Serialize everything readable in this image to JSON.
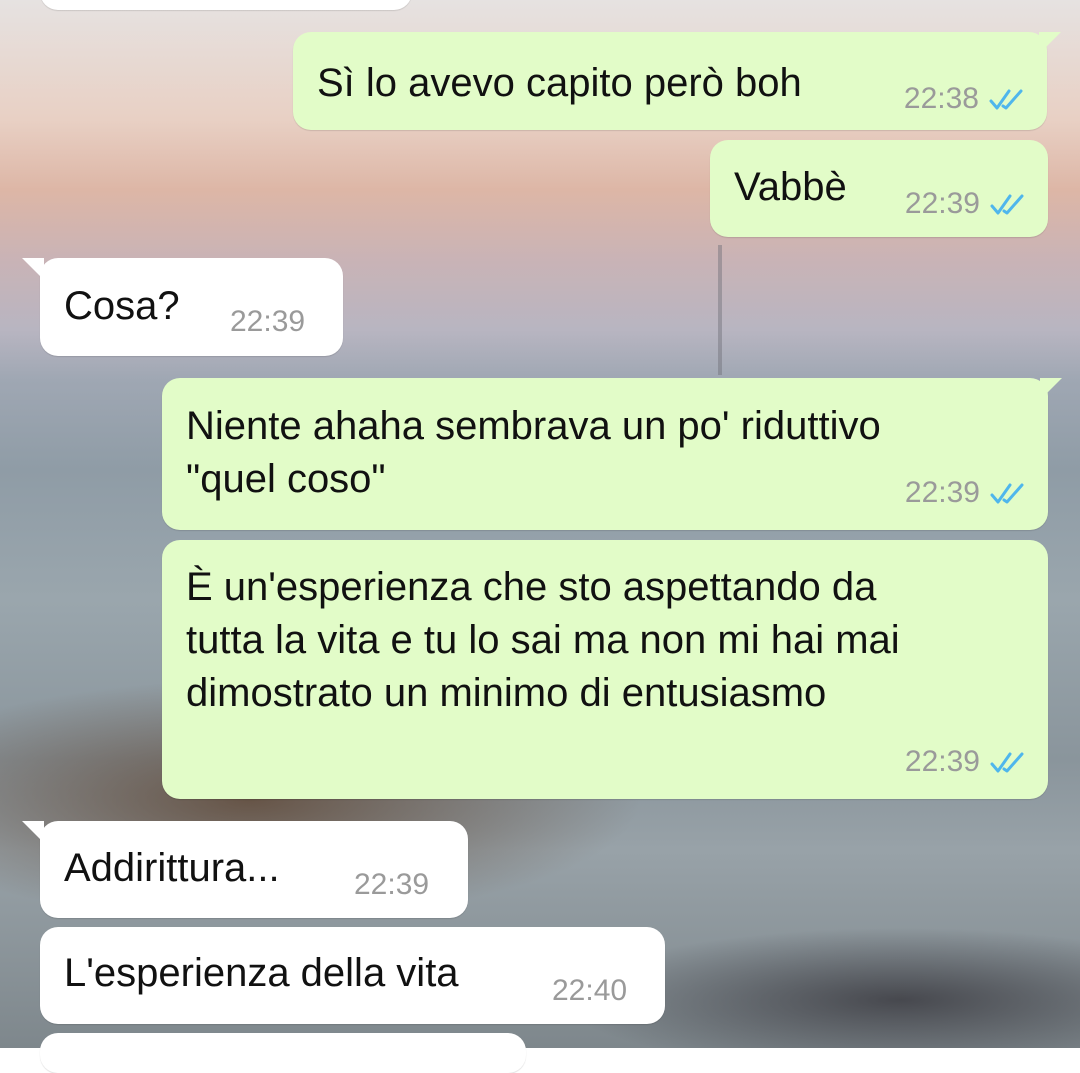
{
  "chat": {
    "messages": [
      {
        "direction": "outgoing",
        "text": "Sì lo avevo capito però boh",
        "time": "22:38",
        "status": "read"
      },
      {
        "direction": "outgoing",
        "text": "Vabbè",
        "time": "22:39",
        "status": "read"
      },
      {
        "direction": "incoming",
        "text": "Cosa?",
        "time": "22:39"
      },
      {
        "direction": "outgoing",
        "text_lines": [
          "Niente ahaha sembrava un po' riduttivo",
          "\"quel coso\""
        ],
        "time": "22:39",
        "status": "read"
      },
      {
        "direction": "outgoing",
        "text_lines": [
          "È un'esperienza che sto aspettando da",
          "tutta la vita e tu lo sai ma non mi hai mai",
          "dimostrato un minimo di entusiasmo"
        ],
        "time": "22:39",
        "status": "read"
      },
      {
        "direction": "incoming",
        "text": "Addirittura...",
        "time": "22:39"
      },
      {
        "direction": "incoming",
        "text": "L'esperienza della vita",
        "time": "22:40"
      }
    ]
  },
  "colors": {
    "outgoing_bubble": "#e2fcc8",
    "incoming_bubble": "#ffffff",
    "read_tick": "#4fb6ec",
    "timestamp": "#9a9a9a"
  },
  "icons": {
    "read_status": "double-check-icon"
  }
}
